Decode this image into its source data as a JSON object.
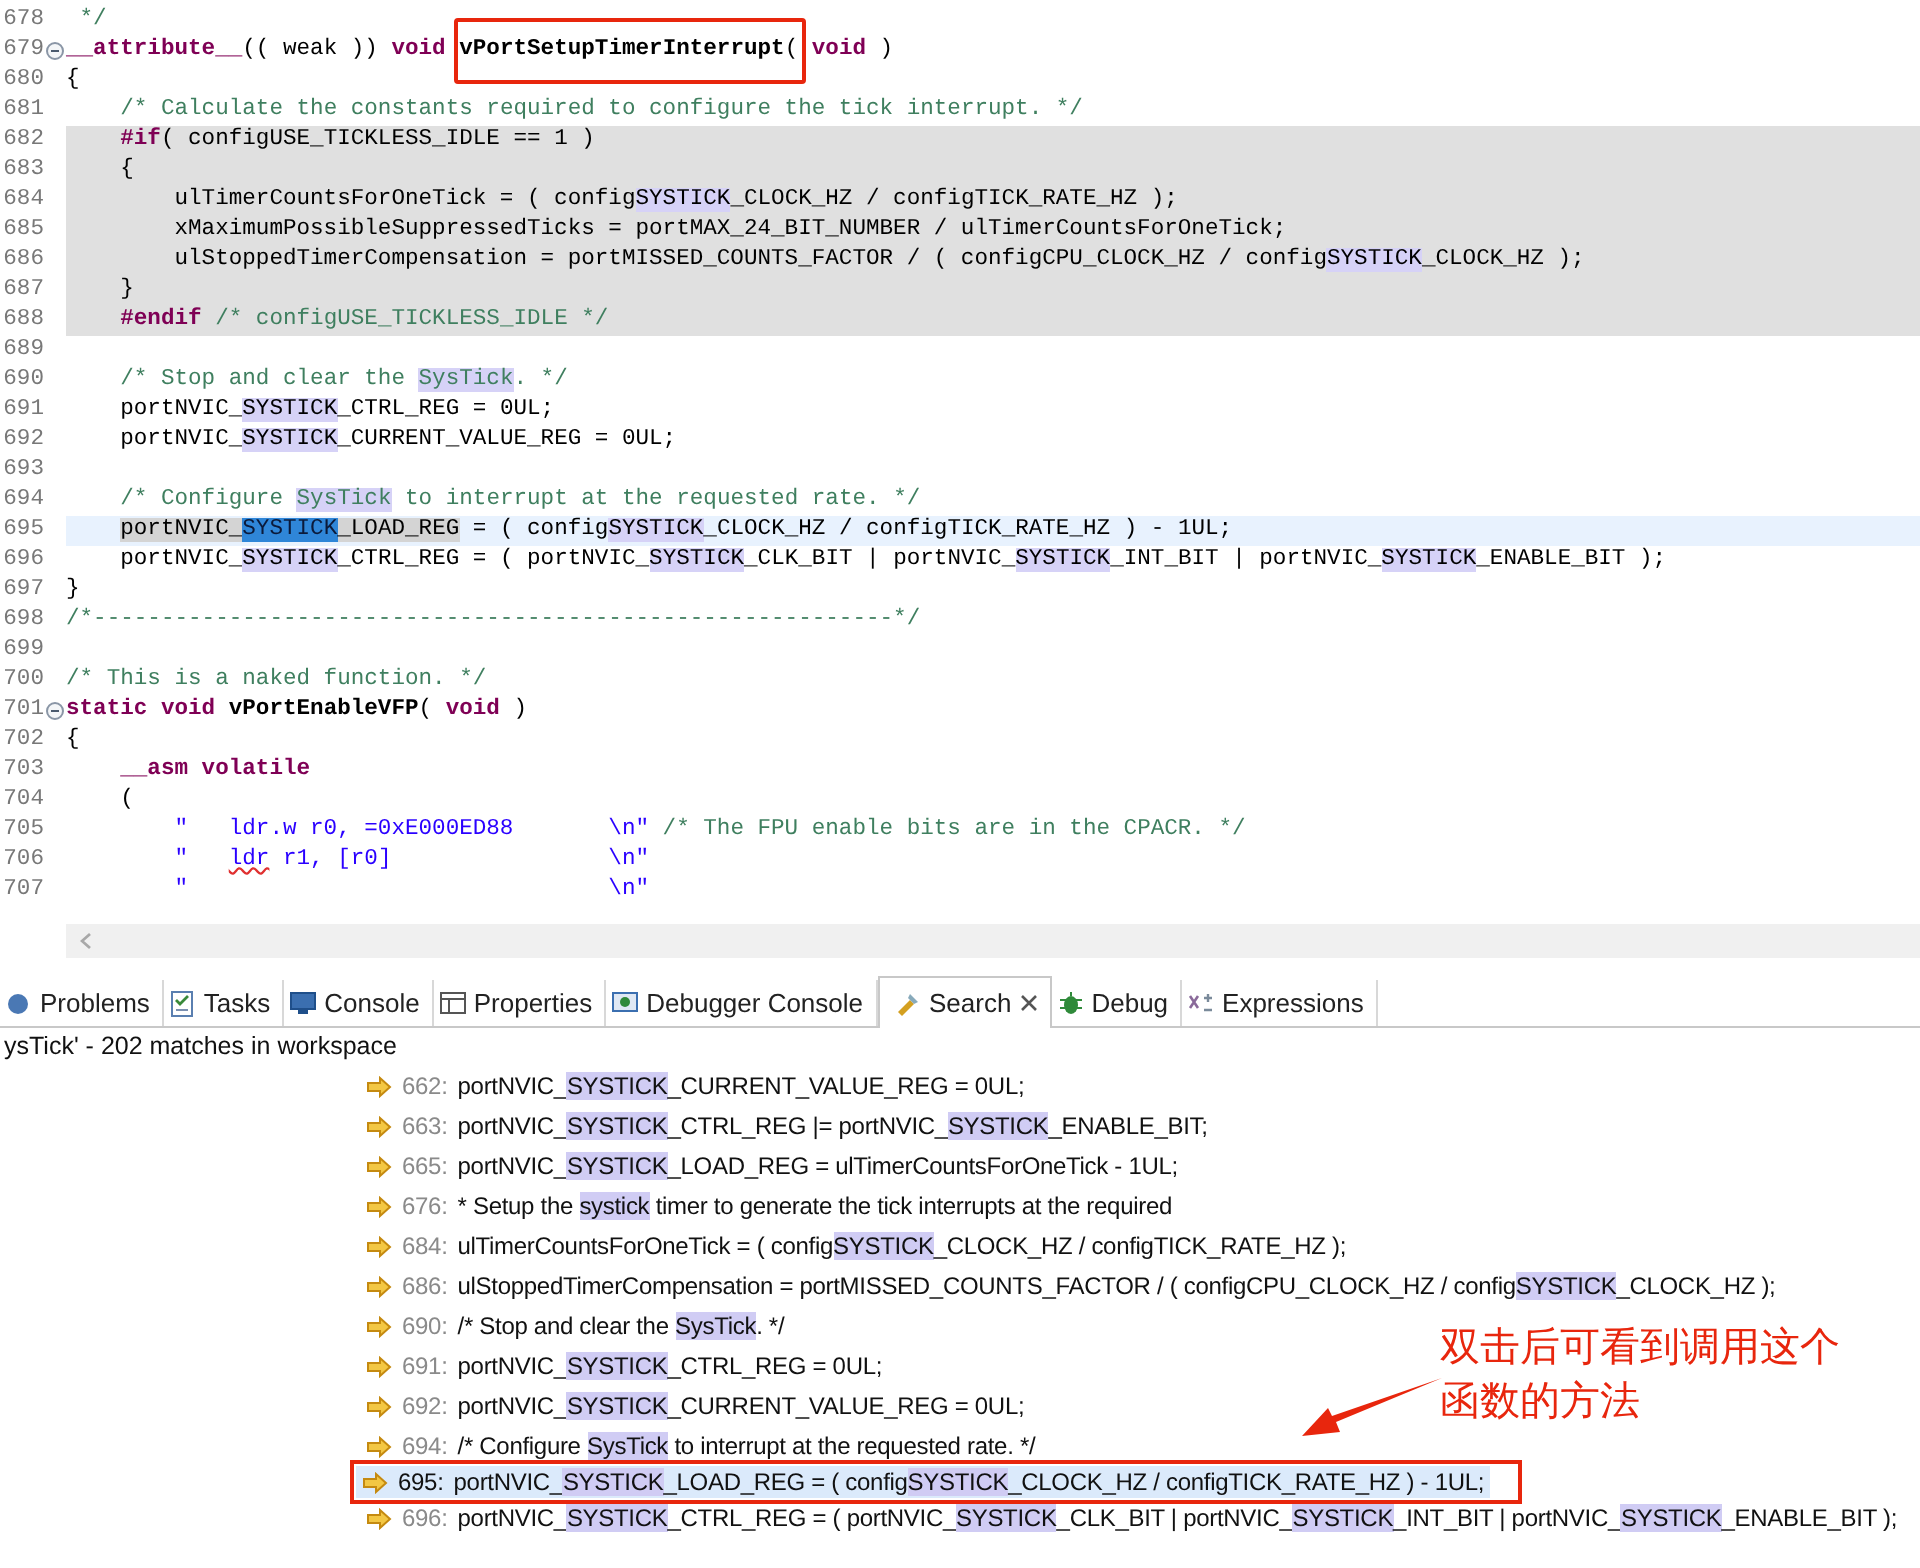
{
  "editor": {
    "lines": [
      {
        "num": "678",
        "fold": false,
        "inactive": false,
        "current": false,
        "segments": [
          {
            "kind": "comment",
            "text": " */"
          }
        ]
      },
      {
        "num": "679",
        "fold": true,
        "inactive": false,
        "current": false,
        "segments": [
          {
            "kind": "kw",
            "text": "__attribute__"
          },
          {
            "text": "(( weak )) "
          },
          {
            "kind": "kw",
            "text": "void "
          },
          {
            "kind": "fn",
            "text": "vPortSetupTimerInterrupt",
            "annotated": true
          },
          {
            "text": "(",
            "annotated": true
          },
          {
            "kind": "kw",
            "text": " void"
          },
          {
            "text": " )"
          }
        ]
      },
      {
        "num": "680",
        "fold": false,
        "inactive": false,
        "current": false,
        "segments": [
          {
            "text": "{"
          }
        ]
      },
      {
        "num": "681",
        "fold": false,
        "inactive": false,
        "current": false,
        "segments": [
          {
            "kind": "comment",
            "text": "    /* Calculate the constants required to configure the tick interrupt. */"
          }
        ]
      },
      {
        "num": "682",
        "fold": false,
        "inactive": true,
        "current": false,
        "segments": [
          {
            "kind": "kw",
            "text": "    #if"
          },
          {
            "text": "( configUSE_TICKLESS_IDLE == 1 )"
          }
        ]
      },
      {
        "num": "683",
        "fold": false,
        "inactive": true,
        "current": false,
        "segments": [
          {
            "text": "    {"
          }
        ]
      },
      {
        "num": "684",
        "fold": false,
        "inactive": true,
        "current": false,
        "segments": [
          {
            "text": "        ulTimerCountsForOneTick = ( config"
          },
          {
            "kind": "match",
            "text": "SYSTICK"
          },
          {
            "text": "_CLOCK_HZ / configTICK_RATE_HZ );"
          }
        ]
      },
      {
        "num": "685",
        "fold": false,
        "inactive": true,
        "current": false,
        "segments": [
          {
            "text": "        xMaximumPossibleSuppressedTicks = portMAX_24_BIT_NUMBER / ulTimerCountsForOneTick;"
          }
        ]
      },
      {
        "num": "686",
        "fold": false,
        "inactive": true,
        "current": false,
        "segments": [
          {
            "text": "        ulStoppedTimerCompensation = portMISSED_COUNTS_FACTOR / ( configCPU_CLOCK_HZ / config"
          },
          {
            "kind": "match",
            "text": "SYSTICK"
          },
          {
            "text": "_CLOCK_HZ );"
          }
        ]
      },
      {
        "num": "687",
        "fold": false,
        "inactive": true,
        "current": false,
        "segments": [
          {
            "text": "    }"
          }
        ]
      },
      {
        "num": "688",
        "fold": false,
        "inactive": true,
        "current": false,
        "segments": [
          {
            "kind": "kw",
            "text": "    #endif"
          },
          {
            "kind": "comment",
            "text": " /* configUSE_TICKLESS_IDLE */"
          }
        ]
      },
      {
        "num": "689",
        "fold": false,
        "inactive": false,
        "current": false
      },
      {
        "num": "690",
        "fold": false,
        "inactive": false,
        "current": false,
        "segments": [
          {
            "kind": "comment",
            "text": "    /* Stop and clear the "
          },
          {
            "kind": "comment_match",
            "text": "SysTick"
          },
          {
            "kind": "comment",
            "text": ". */"
          }
        ]
      },
      {
        "num": "691",
        "fold": false,
        "inactive": false,
        "current": false,
        "segments": [
          {
            "text": "    portNVIC_"
          },
          {
            "kind": "match",
            "text": "SYSTICK"
          },
          {
            "text": "_CTRL_REG = 0UL;"
          }
        ]
      },
      {
        "num": "692",
        "fold": false,
        "inactive": false,
        "current": false,
        "segments": [
          {
            "text": "    portNVIC_"
          },
          {
            "kind": "match",
            "text": "SYSTICK"
          },
          {
            "text": "_CURRENT_VALUE_REG = 0UL;"
          }
        ]
      },
      {
        "num": "693",
        "fold": false,
        "inactive": false,
        "current": false
      },
      {
        "num": "694",
        "fold": false,
        "inactive": false,
        "current": false,
        "segments": [
          {
            "kind": "comment",
            "text": "    /* Configure "
          },
          {
            "kind": "comment_match",
            "text": "SysTick"
          },
          {
            "kind": "comment",
            "text": " to interrupt at the requested rate. */"
          }
        ]
      },
      {
        "num": "695",
        "fold": false,
        "inactive": false,
        "current": true,
        "segments": [
          {
            "kind": "occurrence",
            "text": "    portNVIC_"
          },
          {
            "kind": "selection",
            "text": "SYSTICK"
          },
          {
            "kind": "occurrence",
            "text": "_LOAD_REG"
          },
          {
            "text": " = ( config"
          },
          {
            "kind": "match",
            "text": "SYSTICK"
          },
          {
            "text": "_CLOCK_HZ / configTICK_RATE_HZ ) - 1UL;"
          }
        ]
      },
      {
        "num": "696",
        "fold": false,
        "inactive": false,
        "current": false,
        "segments": [
          {
            "text": "    portNVIC_"
          },
          {
            "kind": "match",
            "text": "SYSTICK"
          },
          {
            "text": "_CTRL_REG = ( portNVIC_"
          },
          {
            "kind": "match",
            "text": "SYSTICK"
          },
          {
            "text": "_CLK_BIT | portNVIC_"
          },
          {
            "kind": "match",
            "text": "SYSTICK"
          },
          {
            "text": "_INT_BIT | portNVIC_"
          },
          {
            "kind": "match",
            "text": "SYSTICK"
          },
          {
            "text": "_ENABLE_BIT );"
          }
        ]
      },
      {
        "num": "697",
        "fold": false,
        "inactive": false,
        "current": false,
        "segments": [
          {
            "text": "}"
          }
        ]
      },
      {
        "num": "698",
        "fold": false,
        "inactive": false,
        "current": false,
        "segments": [
          {
            "kind": "comment",
            "text": "/*-----------------------------------------------------------*/"
          }
        ]
      },
      {
        "num": "699",
        "fold": false,
        "inactive": false,
        "current": false
      },
      {
        "num": "700",
        "fold": false,
        "inactive": false,
        "current": false,
        "segments": [
          {
            "kind": "comment",
            "text": "/* This is a naked function. */"
          }
        ]
      },
      {
        "num": "701",
        "fold": true,
        "inactive": false,
        "current": false,
        "segments": [
          {
            "kind": "kw",
            "text": "static void "
          },
          {
            "kind": "fn",
            "text": "vPortEnableVFP"
          },
          {
            "text": "( "
          },
          {
            "kind": "kw",
            "text": "void"
          },
          {
            "text": " )"
          }
        ]
      },
      {
        "num": "702",
        "fold": false,
        "inactive": false,
        "current": false,
        "segments": [
          {
            "text": "{"
          }
        ]
      },
      {
        "num": "703",
        "fold": false,
        "inactive": false,
        "current": false,
        "segments": [
          {
            "kind": "kw",
            "text": "    __asm volatile"
          }
        ]
      },
      {
        "num": "704",
        "fold": false,
        "inactive": false,
        "current": false,
        "segments": [
          {
            "text": "    ("
          }
        ]
      },
      {
        "num": "705",
        "fold": false,
        "inactive": false,
        "current": false,
        "segments": [
          {
            "kind": "str",
            "text": "        \"   ldr.w r0, =0xE000ED88       \\n\""
          },
          {
            "kind": "comment",
            "text": " /* The FPU enable bits are in the CPACR. */"
          }
        ]
      },
      {
        "num": "706",
        "fold": false,
        "inactive": false,
        "current": false,
        "segments": [
          {
            "kind": "str",
            "text": "        \"   "
          },
          {
            "kind": "str_squiggle",
            "text": "ldr"
          },
          {
            "kind": "str",
            "text": " r1, [r0]                \\n\""
          }
        ]
      },
      {
        "num": "707",
        "fold": false,
        "inactive": false,
        "current": false,
        "segments": [
          {
            "kind": "str",
            "text": "        \"                               \\n\""
          }
        ]
      }
    ]
  },
  "tabs": [
    {
      "label": "Problems",
      "selected": false,
      "closable": false
    },
    {
      "label": "Tasks",
      "selected": false,
      "closable": false
    },
    {
      "label": "Console",
      "selected": false,
      "closable": false
    },
    {
      "label": "Properties",
      "selected": false,
      "closable": false
    },
    {
      "label": "Debugger Console",
      "selected": false,
      "closable": false
    },
    {
      "label": "Search",
      "selected": true,
      "closable": true
    },
    {
      "label": "Debug",
      "selected": false,
      "closable": false
    },
    {
      "label": "Expressions",
      "selected": false,
      "closable": false
    }
  ],
  "search": {
    "summary": "ysTick' - 202 matches in workspace",
    "results": [
      {
        "line": "662:",
        "selected": false,
        "annotated": false,
        "segments": [
          {
            "text": "portNVIC_"
          },
          {
            "kind": "match",
            "text": "SYSTICK"
          },
          {
            "text": "_CURRENT_VALUE_REG = 0UL;"
          }
        ]
      },
      {
        "line": "663:",
        "selected": false,
        "annotated": false,
        "segments": [
          {
            "text": "portNVIC_"
          },
          {
            "kind": "match",
            "text": "SYSTICK"
          },
          {
            "text": "_CTRL_REG |= portNVIC_"
          },
          {
            "kind": "match",
            "text": "SYSTICK"
          },
          {
            "text": "_ENABLE_BIT;"
          }
        ]
      },
      {
        "line": "665:",
        "selected": false,
        "annotated": false,
        "segments": [
          {
            "text": "portNVIC_"
          },
          {
            "kind": "match",
            "text": "SYSTICK"
          },
          {
            "text": "_LOAD_REG = ulTimerCountsForOneTick - 1UL;"
          }
        ]
      },
      {
        "line": "676:",
        "selected": false,
        "annotated": false,
        "segments": [
          {
            "text": "* Setup the "
          },
          {
            "kind": "match",
            "text": "systick"
          },
          {
            "text": " timer to generate the tick interrupts at the required"
          }
        ]
      },
      {
        "line": "684:",
        "selected": false,
        "annotated": false,
        "segments": [
          {
            "text": "ulTimerCountsForOneTick = ( config"
          },
          {
            "kind": "match",
            "text": "SYSTICK"
          },
          {
            "text": "_CLOCK_HZ / configTICK_RATE_HZ );"
          }
        ]
      },
      {
        "line": "686:",
        "selected": false,
        "annotated": false,
        "segments": [
          {
            "text": "ulStoppedTimerCompensation = portMISSED_COUNTS_FACTOR / ( configCPU_CLOCK_HZ / config"
          },
          {
            "kind": "match",
            "text": "SYSTICK"
          },
          {
            "text": "_CLOCK_HZ );"
          }
        ]
      },
      {
        "line": "690:",
        "selected": false,
        "annotated": false,
        "segments": [
          {
            "text": "/* Stop and clear the "
          },
          {
            "kind": "match",
            "text": "SysTick"
          },
          {
            "text": ". */"
          }
        ]
      },
      {
        "line": "691:",
        "selected": false,
        "annotated": false,
        "segments": [
          {
            "text": "portNVIC_"
          },
          {
            "kind": "match",
            "text": "SYSTICK"
          },
          {
            "text": "_CTRL_REG = 0UL;"
          }
        ]
      },
      {
        "line": "692:",
        "selected": false,
        "annotated": false,
        "segments": [
          {
            "text": "portNVIC_"
          },
          {
            "kind": "match",
            "text": "SYSTICK"
          },
          {
            "text": "_CURRENT_VALUE_REG = 0UL;"
          }
        ]
      },
      {
        "line": "694:",
        "selected": false,
        "annotated": false,
        "segments": [
          {
            "text": "/* Configure "
          },
          {
            "kind": "match",
            "text": "SysTick"
          },
          {
            "text": " to interrupt at the requested rate. */"
          }
        ]
      },
      {
        "line": "695:",
        "selected": true,
        "annotated": true,
        "segments": [
          {
            "text": "portNVIC_"
          },
          {
            "kind": "match",
            "text": "SYSTICK"
          },
          {
            "text": "_LOAD_REG = ( config"
          },
          {
            "kind": "match",
            "text": "SYSTICK"
          },
          {
            "text": "_CLOCK_HZ / configTICK_RATE_HZ ) - 1UL;"
          }
        ]
      },
      {
        "line": "696:",
        "selected": false,
        "annotated": false,
        "segments": [
          {
            "text": "portNVIC_"
          },
          {
            "kind": "match",
            "text": "SYSTICK"
          },
          {
            "text": "_CTRL_REG = ( portNVIC_"
          },
          {
            "kind": "match",
            "text": "SYSTICK"
          },
          {
            "text": "_CLK_BIT | portNVIC_"
          },
          {
            "kind": "match",
            "text": "SYSTICK"
          },
          {
            "text": "_INT_BIT | portNVIC_"
          },
          {
            "kind": "match",
            "text": "SYSTICK"
          },
          {
            "text": "_ENABLE_BIT );"
          }
        ]
      }
    ]
  },
  "callout": {
    "text": "双击后可看到调用这个函数的方法"
  }
}
